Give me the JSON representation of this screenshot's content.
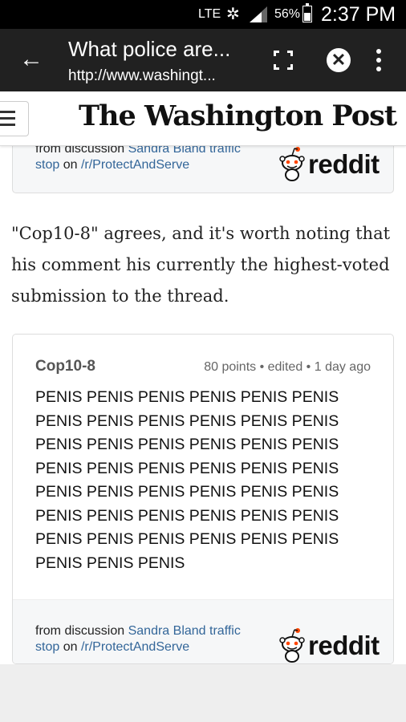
{
  "status_bar": {
    "network": "LTE",
    "battery_percent": "56%",
    "time": "2:37 PM",
    "icons": [
      "sync-icon",
      "signal-icon",
      "battery-icon"
    ]
  },
  "toolbar": {
    "title": "What police are...",
    "url": "http://www.washingt...",
    "icons": [
      "back-arrow-icon",
      "fullscreen-icon",
      "close-icon",
      "more-vert-icon"
    ],
    "close_glyph": "✕",
    "back_glyph": "←"
  },
  "header": {
    "masthead": "The Washington Post"
  },
  "top_embed": {
    "from_prefix": "from discussion",
    "discussion_link": "Sandra Bland traffic stop",
    "on_text": "on",
    "subreddit_link": "/r/ProtectAndServe",
    "brand": "reddit"
  },
  "article": {
    "paragraph": "\"Cop10-8\" agrees, and it's worth noting that his comment his currently the highest-voted submission to the thread."
  },
  "comment": {
    "author": "Cop10-8",
    "meta": "80 points • edited • 1 day ago",
    "body": "PENIS PENIS PENIS PENIS PENIS PENIS PENIS PENIS PENIS PENIS PENIS PENIS PENIS PENIS PENIS PENIS PENIS PENIS PENIS PENIS PENIS PENIS PENIS PENIS PENIS PENIS PENIS PENIS PENIS PENIS PENIS PENIS PENIS PENIS PENIS PENIS PENIS PENIS PENIS PENIS PENIS PENIS PENIS PENIS PENIS",
    "footer": {
      "from_prefix": "from discussion",
      "discussion_link": "Sandra Bland traffic stop",
      "on_text": "on",
      "subreddit_link": "/r/ProtectAndServe",
      "brand": "reddit"
    }
  },
  "colors": {
    "toolbar_bg": "#212121",
    "link": "#336699",
    "embed_bg": "#f6f7f8",
    "snoo_accent": "#ff4500"
  }
}
